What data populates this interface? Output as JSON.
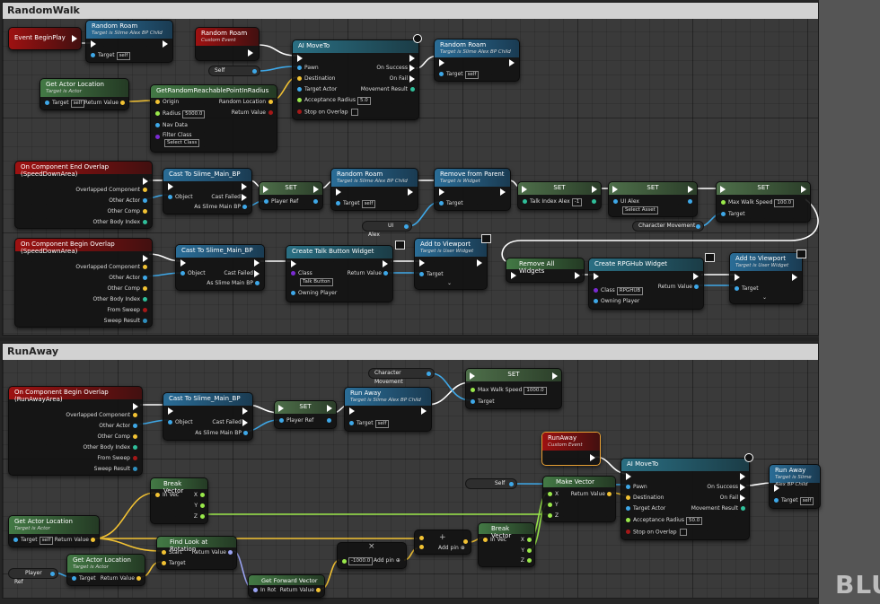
{
  "graphs": {
    "random_walk": {
      "title": "RandomWalk"
    },
    "run_away": {
      "title": "RunAway"
    }
  },
  "watermark": "BLU",
  "nodes": {
    "event_begin_play": {
      "title": "Event BeginPlay"
    },
    "random_roam_call_1": {
      "title": "Random Roam",
      "subtitle": "Target is Slime Alex BP Child",
      "target": "Target",
      "target_value": "self"
    },
    "random_roam_event": {
      "title": "Random Roam",
      "subtitle": "Custom Event"
    },
    "self_var_1": {
      "label": "Self"
    },
    "ai_move_to_1": {
      "title": "AI MoveTo",
      "pawn": "Pawn",
      "destination": "Destination",
      "target_actor": "Target Actor",
      "acceptance_radius": "Acceptance Radius",
      "acceptance_radius_value": "5.0",
      "stop_on_overlap": "Stop on Overlap",
      "on_success": "On Success",
      "on_fail": "On Fail",
      "movement_result": "Movement Result"
    },
    "random_roam_call_2": {
      "title": "Random Roam",
      "subtitle": "Target is Slime Alex BP Child",
      "target": "Target",
      "target_value": "self"
    },
    "get_actor_location_1": {
      "title": "Get Actor Location",
      "subtitle": "Target is Actor",
      "target": "Target",
      "target_value": "self",
      "return_value": "Return Value"
    },
    "get_random_reachable": {
      "title": "GetRandomReachablePointInRadius",
      "origin": "Origin",
      "radius": "Radius",
      "radius_value": "5000.0",
      "nav_data": "Nav Data",
      "filter_class": "Filter Class",
      "filter_class_value": "Select Class",
      "random_location": "Random Location",
      "return_value": "Return Value"
    },
    "end_overlap_speed": {
      "title": "On Component End Overlap (SpeedDownArea)",
      "pins": [
        "Overlapped Component",
        "Other Actor",
        "Other Comp",
        "Other Body Index"
      ]
    },
    "cast_slime_1": {
      "title": "Cast To Slime_Main_BP",
      "object": "Object",
      "cast_failed": "Cast Failed",
      "as_slime": "As Slime Main BP"
    },
    "set_player_ref": {
      "title": "SET",
      "pin": "Player Ref"
    },
    "random_roam_call_3": {
      "title": "Random Roam",
      "subtitle": "Target is Slime Alex BP Child",
      "target": "Target",
      "target_value": "self"
    },
    "remove_from_parent": {
      "title": "Remove from Parent",
      "subtitle": "Target is Widget",
      "target": "Target"
    },
    "set_talk_index": {
      "title": "SET",
      "pin": "Talk Index Alex",
      "pin_value": "-1"
    },
    "set_ui_alex": {
      "title": "SET",
      "pin": "UI Alex",
      "pin_value": "Select Asset"
    },
    "set_max_walk_1": {
      "title": "SET",
      "pin": "Max Walk Speed",
      "pin_value": "100.0",
      "target": "Target"
    },
    "ui_alex_var": {
      "label": "UI Alex"
    },
    "character_movement_var_1": {
      "label": "Character Movement"
    },
    "begin_overlap_speed": {
      "title": "On Component Begin Overlap (SpeedDownArea)",
      "pins": [
        "Overlapped Component",
        "Other Actor",
        "Other Comp",
        "Other Body Index",
        "From Sweep",
        "Sweep Result"
      ]
    },
    "cast_slime_2": {
      "title": "Cast To Slime_Main_BP",
      "object": "Object",
      "cast_failed": "Cast Failed",
      "as_slime": "As Slime Main BP"
    },
    "create_talk_button": {
      "title": "Create Talk Button Widget",
      "class": "Class",
      "class_value": "Talk Button",
      "owning_player": "Owning Player",
      "return_value": "Return Value"
    },
    "add_to_viewport_1": {
      "title": "Add to Viewport",
      "subtitle": "Target is User Widget",
      "target": "Target"
    },
    "remove_all_widgets": {
      "title": "Remove All Widgets"
    },
    "create_rpg_hub": {
      "title": "Create RPGHub Widget",
      "class": "Class",
      "class_value": "RPGHUB",
      "owning_player": "Owning Player",
      "return_value": "Return Value"
    },
    "add_to_viewport_2": {
      "title": "Add to Viewport",
      "subtitle": "Target is User Widget",
      "target": "Target"
    },
    "character_movement_var_2": {
      "label": "Character Movement"
    },
    "set_max_walk_2": {
      "title": "SET",
      "pin": "Max Walk Speed",
      "pin_value": "1000.0",
      "target": "Target"
    },
    "begin_overlap_run": {
      "title": "On Component Begin Overlap (RunAwayArea)",
      "pins": [
        "Overlapped Component",
        "Other Actor",
        "Other Comp",
        "Other Body Index",
        "From Sweep",
        "Sweep Result"
      ]
    },
    "cast_slime_3": {
      "title": "Cast To Slime_Main_BP",
      "object": "Object",
      "cast_failed": "Cast Failed",
      "as_slime": "As Slime Main BP"
    },
    "set_player_ref_2": {
      "title": "SET",
      "pin": "Player Ref"
    },
    "run_away_call_1": {
      "title": "Run Away",
      "subtitle": "Target is Slime Alex BP Child",
      "target": "Target",
      "target_value": "self"
    },
    "run_away_event": {
      "title": "RunAway",
      "subtitle": "Custom Event"
    },
    "self_var_2": {
      "label": "Self"
    },
    "make_vector": {
      "title": "Make Vector",
      "x": "X",
      "y": "Y",
      "z": "Z",
      "return_value": "Return Value"
    },
    "ai_move_to_2": {
      "title": "AI MoveTo",
      "pawn": "Pawn",
      "destination": "Destination",
      "target_actor": "Target Actor",
      "acceptance_radius": "Acceptance Radius",
      "acceptance_radius_value": "50.0",
      "stop_on_overlap": "Stop on Overlap",
      "on_success": "On Success",
      "on_fail": "On Fail",
      "movement_result": "Movement Result"
    },
    "run_away_call_2": {
      "title": "Run Away",
      "subtitle": "Target is Slime Alex BP Child",
      "target": "Target",
      "target_value": "self"
    },
    "break_vector_1": {
      "title": "Break Vector",
      "in_vec": "In Vec",
      "x": "X",
      "y": "Y",
      "z": "Z"
    },
    "get_actor_location_2": {
      "title": "Get Actor Location",
      "subtitle": "Target is Actor",
      "target": "Target",
      "target_value": "self",
      "return_value": "Return Value"
    },
    "find_look_at": {
      "title": "Find Look at Rotation",
      "start": "Start",
      "target": "Target",
      "return_value": "Return Value"
    },
    "player_ref_var": {
      "label": "Player Ref"
    },
    "get_actor_location_3": {
      "title": "Get Actor Location",
      "subtitle": "Target is Actor",
      "target": "Target",
      "return_value": "Return Value"
    },
    "get_forward_vector": {
      "title": "Get Forward Vector",
      "in_rot": "In Rot",
      "return_value": "Return Value"
    },
    "multiply": {
      "value": "-1000.0",
      "add_pin": "Add pin"
    },
    "add": {
      "add_pin": "Add pin"
    },
    "break_vector_2": {
      "title": "Break Vector",
      "in_vec": "In Vec",
      "x": "X",
      "y": "Y",
      "z": "Z"
    }
  },
  "colors": {
    "exec": "#ffffff",
    "object": "#3ea8e8",
    "vector": "#f2c233",
    "float": "#99e84a",
    "rotator": "#9aa3f2",
    "class": "#7a2bd1",
    "bool": "#a51818",
    "struct": "#2f8fbf"
  }
}
